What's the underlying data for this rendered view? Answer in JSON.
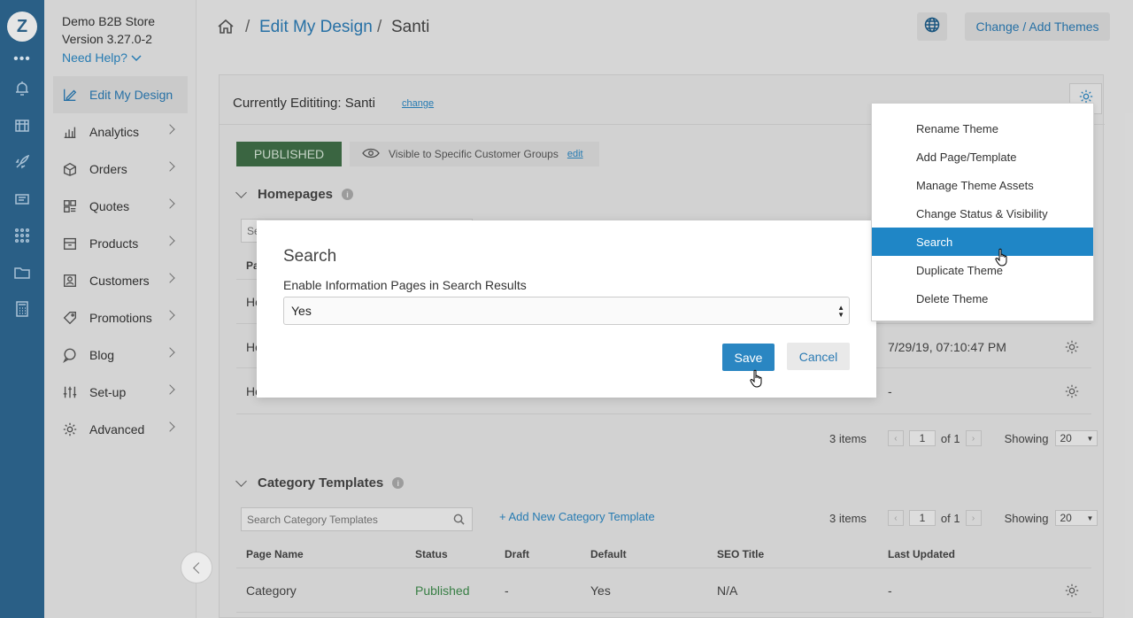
{
  "rail": {
    "logo": "Z",
    "more": "•••"
  },
  "sidebar": {
    "store_name": "Demo B2B Store",
    "version": "Version 3.27.0-2",
    "need_help": "Need Help?",
    "items": [
      {
        "label": "Edit My Design",
        "icon": "edit-design-icon",
        "active": true
      },
      {
        "label": "Analytics",
        "icon": "bar-chart-icon"
      },
      {
        "label": "Orders",
        "icon": "orders-icon"
      },
      {
        "label": "Quotes",
        "icon": "quotes-icon"
      },
      {
        "label": "Products",
        "icon": "box-icon"
      },
      {
        "label": "Customers",
        "icon": "customer-icon"
      },
      {
        "label": "Promotions",
        "icon": "tag-icon"
      },
      {
        "label": "Blog",
        "icon": "comment-icon"
      },
      {
        "label": "Set-up",
        "icon": "sliders-icon"
      },
      {
        "label": "Advanced",
        "icon": "gear-icon"
      }
    ]
  },
  "header": {
    "crumb_link": "Edit My Design",
    "crumb_current": "Santi",
    "sep": "/",
    "change_themes": "Change / Add Themes"
  },
  "panel": {
    "currently": "Currently Edititing: Santi",
    "change": "change",
    "status": "PUBLISHED",
    "visibility": "Visible to Specific Customer Groups",
    "visibility_edit": "edit"
  },
  "homepages": {
    "title": "Homepages",
    "rows": [
      {
        "name": "Ho",
        "updated": ""
      },
      {
        "name": "Ho",
        "updated": "7/29/19, 07:10:47 PM"
      },
      {
        "name": "Ho",
        "updated": "-"
      }
    ],
    "col_first": "Pa",
    "search_first": "Se",
    "items_count": "3 items",
    "page": "1",
    "of": "of 1",
    "showing": "Showing",
    "per_page": "20"
  },
  "category": {
    "title": "Category Templates",
    "search_placeholder": "Search Category Templates",
    "add_link": "+ Add New Category Template",
    "items_count": "3 items",
    "page": "1",
    "of": "of 1",
    "showing": "Showing",
    "per_page": "20",
    "columns": [
      "Page Name",
      "Status",
      "Draft",
      "Default",
      "SEO Title",
      "Last Updated"
    ],
    "row": {
      "name": "Category",
      "status": "Published",
      "draft": "-",
      "default": "Yes",
      "seo": "N/A",
      "updated": "-"
    }
  },
  "modal": {
    "title": "Search",
    "label": "Enable Information Pages in Search Results",
    "value": "Yes",
    "save": "Save",
    "cancel": "Cancel"
  },
  "menu": {
    "items": [
      "Rename Theme",
      "Add Page/Template",
      "Manage Theme Assets",
      "Change Status & Visibility",
      "Search",
      "Duplicate Theme",
      "Delete Theme"
    ],
    "highlighted": "Search"
  },
  "colors": {
    "accent": "#2a86c2",
    "rail": "#2a5f86",
    "published": "#3f6e47",
    "menu_highlight": "#1f86c6"
  }
}
